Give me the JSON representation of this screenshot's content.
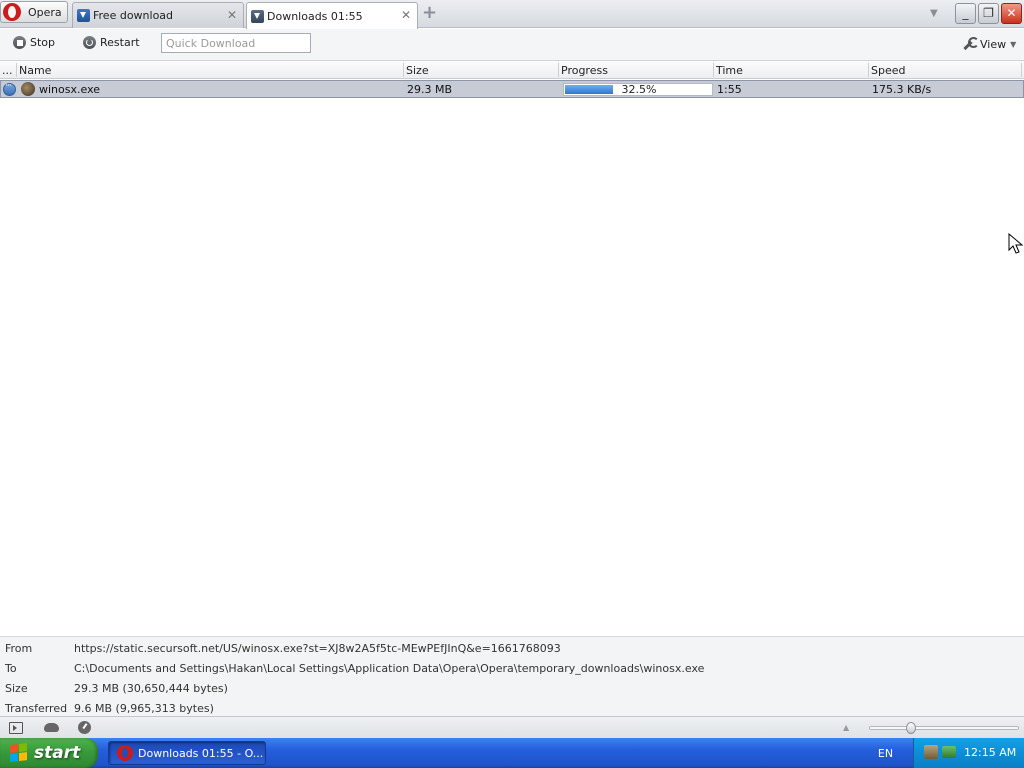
{
  "window": {
    "menu_label": "Opera",
    "tabs": [
      {
        "label": "Free download"
      },
      {
        "label": "Downloads 01:55"
      }
    ]
  },
  "toolbar": {
    "stop_label": "Stop",
    "restart_label": "Restart",
    "quick_download_placeholder": "Quick Download",
    "view_label": "View"
  },
  "list": {
    "columns": [
      "...",
      "Name",
      "Size",
      "Progress",
      "Time",
      "Speed"
    ],
    "rows": [
      {
        "name": "winosx.exe",
        "size": "29.3 MB",
        "progress_text": "32.5%",
        "progress_value": 0.325,
        "time": "1:55",
        "speed": "175.3 KB/s"
      }
    ]
  },
  "details": {
    "from_label": "From",
    "from_value": "https://static.secursoft.net/US/winosx.exe?st=XJ8w2A5f5tc-MEwPEfJInQ&e=1661768093",
    "to_label": "To",
    "to_value": "C:\\Documents and Settings\\Hakan\\Local Settings\\Application Data\\Opera\\Opera\\temporary_downloads\\winosx.exe",
    "size_label": "Size",
    "size_value": "29.3 MB (30,650,444 bytes)",
    "transferred_label": "Transferred",
    "transferred_value": "9.6 MB (9,965,313 bytes)"
  },
  "taskbar": {
    "start_label": "start",
    "task_label": "Downloads 01:55 - O...",
    "language": "EN",
    "clock": "12:15 AM"
  },
  "colors": {
    "selected_row": "#c6cbd5",
    "progress_fill": "#2a78cf",
    "taskbar_blue": "#245edb",
    "start_green": "#37983a"
  }
}
